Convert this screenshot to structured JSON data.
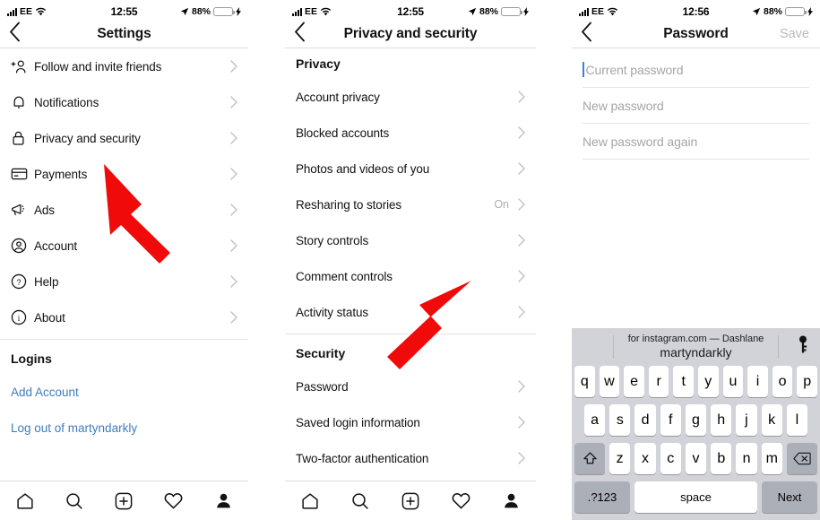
{
  "panels": [
    {
      "status": {
        "carrier": "EE",
        "time": "12:55",
        "battery_pct": "88%"
      },
      "nav": {
        "title": "Settings"
      },
      "items": [
        {
          "icon": "add-person-icon",
          "label": "Follow and invite friends"
        },
        {
          "icon": "bell-icon",
          "label": "Notifications"
        },
        {
          "icon": "lock-icon",
          "label": "Privacy and security"
        },
        {
          "icon": "credit-card-icon",
          "label": "Payments"
        },
        {
          "icon": "megaphone-icon",
          "label": "Ads"
        },
        {
          "icon": "account-circle-icon",
          "label": "Account"
        },
        {
          "icon": "help-circle-icon",
          "label": "Help"
        },
        {
          "icon": "info-circle-icon",
          "label": "About"
        }
      ],
      "logins_header": "Logins",
      "links": [
        {
          "label": "Add Account"
        },
        {
          "label": "Log out of martyndarkly"
        }
      ]
    },
    {
      "status": {
        "carrier": "EE",
        "time": "12:55",
        "battery_pct": "88%"
      },
      "nav": {
        "title": "Privacy and security"
      },
      "privacy_header": "Privacy",
      "privacy_items": [
        {
          "label": "Account privacy",
          "value": ""
        },
        {
          "label": "Blocked accounts",
          "value": ""
        },
        {
          "label": "Photos and videos of you",
          "value": ""
        },
        {
          "label": "Resharing to stories",
          "value": "On"
        },
        {
          "label": "Story controls",
          "value": ""
        },
        {
          "label": "Comment controls",
          "value": ""
        },
        {
          "label": "Activity status",
          "value": ""
        }
      ],
      "security_header": "Security",
      "security_items": [
        {
          "label": "Password",
          "value": ""
        },
        {
          "label": "Saved login information",
          "value": ""
        },
        {
          "label": "Two-factor authentication",
          "value": ""
        }
      ]
    },
    {
      "status": {
        "carrier": "EE",
        "time": "12:56",
        "battery_pct": "88%"
      },
      "nav": {
        "title": "Password",
        "action": "Save"
      },
      "fields": [
        {
          "placeholder": "Current password",
          "value": "",
          "focused": true
        },
        {
          "placeholder": "New password",
          "value": "",
          "focused": false
        },
        {
          "placeholder": "New password again",
          "value": "",
          "focused": false
        }
      ],
      "keyboard": {
        "suggestion_line1": "for instagram.com — Dashlane",
        "suggestion_line2": "martyndarkly",
        "row1": [
          "q",
          "w",
          "e",
          "r",
          "t",
          "y",
          "u",
          "i",
          "o",
          "p"
        ],
        "row2": [
          "a",
          "s",
          "d",
          "f",
          "g",
          "h",
          "j",
          "k",
          "l"
        ],
        "row3": [
          "z",
          "x",
          "c",
          "v",
          "b",
          "n",
          "m"
        ],
        "shift_label": "⇧",
        "backspace_label": "⌫",
        "numbers_label": ".?123",
        "space_label": "space",
        "next_label": "Next"
      }
    }
  ],
  "tabbar": {
    "items": [
      {
        "icon": "home-icon",
        "name": "tab-home"
      },
      {
        "icon": "search-icon",
        "name": "tab-search"
      },
      {
        "icon": "add-post-icon",
        "name": "tab-add"
      },
      {
        "icon": "heart-icon",
        "name": "tab-activity"
      },
      {
        "icon": "profile-icon",
        "name": "tab-profile"
      }
    ]
  },
  "annotations": {
    "arrow_color": "#f00a0a",
    "arrows": [
      {
        "name": "arrow-to-privacy-and-security",
        "target": "Privacy and security"
      },
      {
        "name": "arrow-to-password",
        "target": "Password"
      }
    ]
  },
  "colors": {
    "link": "#3e7dc0",
    "battery_green": "#4cd964",
    "chevron": "#c0c0c4",
    "keyboard_bg": "#d1d3d9"
  }
}
